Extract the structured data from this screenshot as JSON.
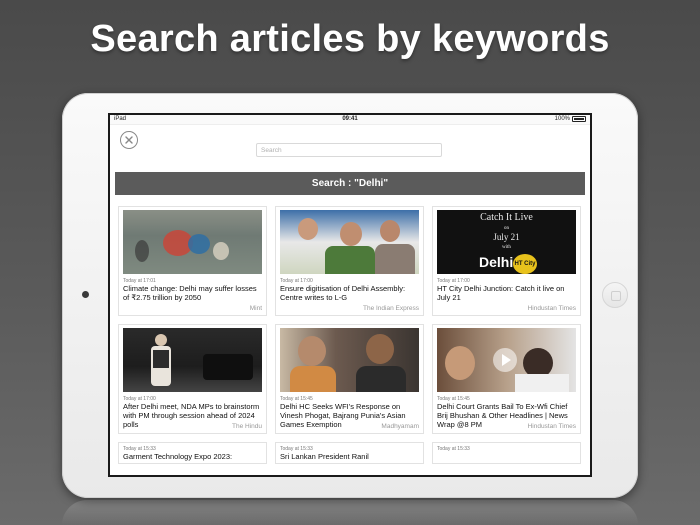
{
  "headline": "Search articles by keywords",
  "statusbar": {
    "device": "iPad",
    "time": "09:41",
    "battery": "100%"
  },
  "search": {
    "placeholder": "Search",
    "value": ""
  },
  "banner": "Search : \"Delhi\"",
  "articles": [
    {
      "time": "Today at 17:01",
      "title": "Climate change: Delhi may suffer losses of  ₹2.75 trillion by 2050",
      "source": "Mint",
      "thumb": "flood-photo"
    },
    {
      "time": "Today at 17:00",
      "title": "Ensure digitisation of Delhi Assembly: Centre writes to L-G",
      "source": "The Indian Express",
      "thumb": "officials-photo"
    },
    {
      "time": "Today at 17:00",
      "title": "HT City Delhi Junction: Catch it live on July 21",
      "source": "Hindustan Times",
      "thumb": "event-poster",
      "poster": {
        "line1": "Catch It Live",
        "line2": "on",
        "line3": "July 21",
        "line4": "with",
        "brand": "HT City",
        "word": "Delhi"
      }
    },
    {
      "time": "Today at 17:00",
      "title": "After Delhi meet, NDA MPs to brainstorm with PM through session ahead of 2024 polls",
      "source": "The Hindu",
      "thumb": "pm-photo"
    },
    {
      "time": "Today at 15:45",
      "title": "Delhi HC Seeks WFI's Response on Vinesh Phogat, Bajrang Punia's Asian Games Exemption",
      "source": "Madhyamam",
      "thumb": "wrestlers-photo"
    },
    {
      "time": "Today at 15:45",
      "title": "Delhi Court Grants Bail To Ex-Wfi Chief Brij Bhushan & Other Headlines | News Wrap @8 PM",
      "source": "Hindustan Times",
      "thumb": "video-thumb"
    },
    {
      "time": "Today at 15:33",
      "title": "Garment Technology Expo 2023:",
      "source": ""
    },
    {
      "time": "Today at 15:33",
      "title": "Sri Lankan President Ranil",
      "source": ""
    },
    {
      "time": "Today at 15:33",
      "title": "",
      "source": ""
    }
  ]
}
